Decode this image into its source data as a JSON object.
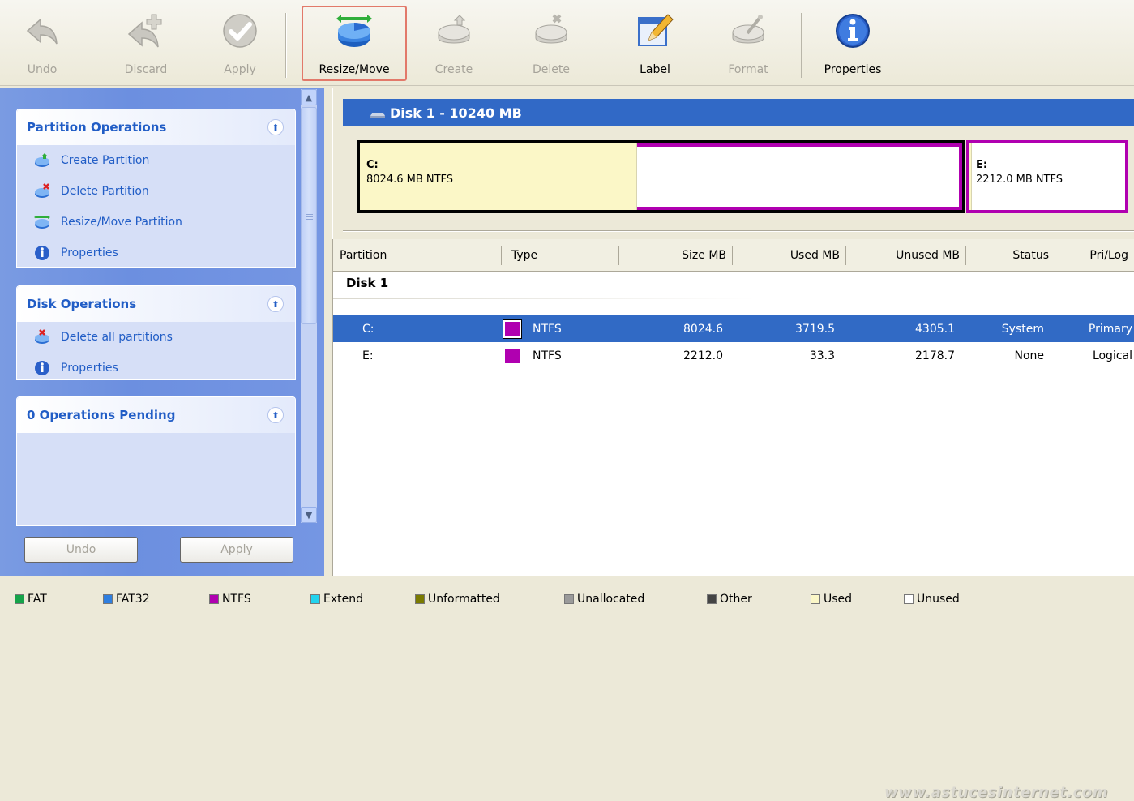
{
  "toolbar": {
    "buttons": [
      {
        "label": "Undo",
        "icon": "undo-arrow-icon",
        "enabled": false
      },
      {
        "label": "Discard",
        "icon": "discard-icon",
        "enabled": false
      },
      {
        "label": "Apply",
        "icon": "checkmark-icon",
        "enabled": false
      },
      {
        "label": "Resize/Move",
        "icon": "resize-move-disk-icon",
        "enabled": true,
        "highlighted": true
      },
      {
        "label": "Create",
        "icon": "create-partition-icon",
        "enabled": false
      },
      {
        "label": "Delete",
        "icon": "delete-partition-icon",
        "enabled": false
      },
      {
        "label": "Label",
        "icon": "label-pencil-icon",
        "enabled": true
      },
      {
        "label": "Format",
        "icon": "format-icon",
        "enabled": false
      },
      {
        "label": "Properties",
        "icon": "info-icon",
        "enabled": true
      }
    ]
  },
  "sidebar": {
    "partition_ops": {
      "title": "Partition Operations",
      "items": [
        {
          "label": "Create Partition",
          "icon": "create-partition-icon"
        },
        {
          "label": "Delete Partition",
          "icon": "delete-partition-icon"
        },
        {
          "label": "Resize/Move Partition",
          "icon": "resize-move-icon"
        },
        {
          "label": "Properties",
          "icon": "info-icon"
        }
      ]
    },
    "disk_ops": {
      "title": "Disk Operations",
      "items": [
        {
          "label": "Delete all partitions",
          "icon": "delete-all-icon"
        },
        {
          "label": "Properties",
          "icon": "info-icon"
        }
      ]
    },
    "pending": {
      "title": "0 Operations Pending"
    },
    "undo_label": "Undo",
    "apply_label": "Apply"
  },
  "disk": {
    "title": "Disk 1 - 10240 MB",
    "partitions": [
      {
        "letter": "C:",
        "info": "8024.6 MB  NTFS",
        "used_fraction": 0.46
      },
      {
        "letter": "E:",
        "info": "2212.0 MB  NTFS",
        "used_fraction": 0.015
      }
    ]
  },
  "list": {
    "columns": [
      "Partition",
      "Type",
      "Size MB",
      "Used MB",
      "Unused MB",
      "Status",
      "Pri/Log"
    ],
    "disk_label": "Disk 1",
    "rows": [
      {
        "partition": "C:",
        "type": "NTFS",
        "size": "8024.6",
        "used": "3719.5",
        "unused": "4305.1",
        "status": "System",
        "prilog": "Primary",
        "selected": true
      },
      {
        "partition": "E:",
        "type": "NTFS",
        "size": "2212.0",
        "used": "33.3",
        "unused": "2178.7",
        "status": "None",
        "prilog": "Logical",
        "selected": false
      }
    ],
    "watermark": "www.astucesinternet.com"
  },
  "legend": [
    {
      "label": "FAT",
      "color": "#16a34a"
    },
    {
      "label": "FAT32",
      "color": "#2f7fe0"
    },
    {
      "label": "NTFS",
      "color": "#b000b0"
    },
    {
      "label": "Extend",
      "color": "#22d3ee"
    },
    {
      "label": "Unformatted",
      "color": "#7a7a00"
    },
    {
      "label": "Unallocated",
      "color": "#9a9a9a"
    },
    {
      "label": "Other",
      "color": "#444444"
    },
    {
      "label": "Used",
      "color": "#fbf7c7"
    },
    {
      "label": "Unused",
      "color": "#ffffff"
    }
  ],
  "colors": {
    "ntfs": "#b000b0",
    "selection": "#316ac5",
    "disk_header": "#3169c6"
  }
}
